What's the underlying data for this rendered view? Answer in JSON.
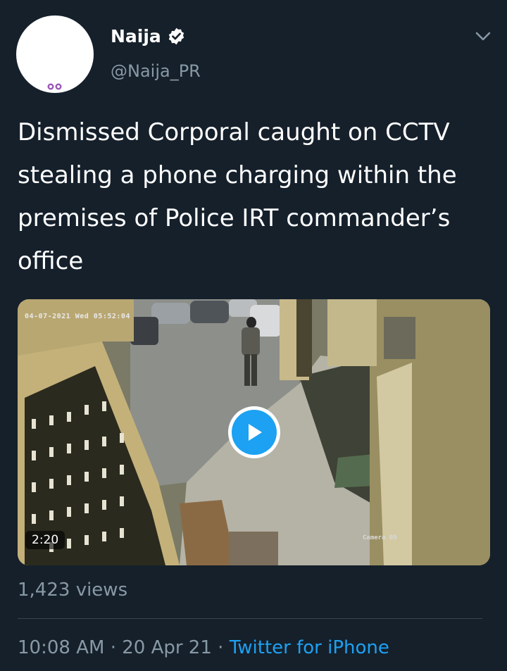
{
  "author": {
    "display_name": "Naija",
    "handle": "@Naija_PR",
    "verified": true
  },
  "tweet": {
    "text": "Dismissed Corporal caught on CCTV\nstealing a phone charging within the\npremises of Police IRT commander’s\noffice"
  },
  "media": {
    "cctv_timestamp": "04-07-2021 Wed 05:52:04",
    "camera_label": "Camera 09",
    "duration": "2:20"
  },
  "stats": {
    "views": "1,423 views"
  },
  "meta": {
    "time": "10:08 AM",
    "separator": "·",
    "date": "20 Apr 21",
    "source": "Twitter for iPhone"
  },
  "colors": {
    "background": "#15202b",
    "accent": "#1da1f2",
    "secondary_text": "#8899a6",
    "divider": "#38444d"
  },
  "icons": [
    "verified-badge-icon",
    "chevron-down-icon",
    "play-icon"
  ]
}
